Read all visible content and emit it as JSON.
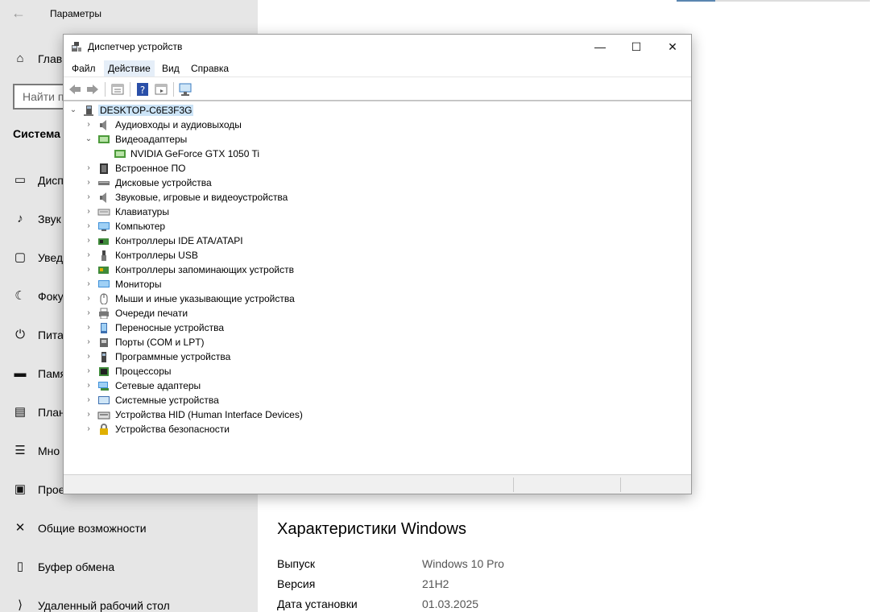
{
  "settings": {
    "title": "Параметры",
    "search_placeholder": "Найти пар",
    "section": "Система",
    "nav": [
      {
        "label": "Глав",
        "icon": "home-icon"
      },
      {
        "label": "Дисп",
        "icon": "display-icon"
      },
      {
        "label": "Звук",
        "icon": "sound-icon"
      },
      {
        "label": "Увед",
        "icon": "notifications-icon"
      },
      {
        "label": "Фоку",
        "icon": "focus-icon"
      },
      {
        "label": "Пита",
        "icon": "power-icon"
      },
      {
        "label": "Памя",
        "icon": "storage-icon"
      },
      {
        "label": "План",
        "icon": "tablet-icon"
      },
      {
        "label": "Мно",
        "icon": "multitasking-icon"
      },
      {
        "label": "Прое",
        "icon": "projecting-icon"
      },
      {
        "label": "Общие возможности",
        "icon": "shared-icon"
      },
      {
        "label": "Буфер обмена",
        "icon": "clipboard-icon"
      },
      {
        "label": "Удаленный рабочий стол",
        "icon": "remote-desktop-icon"
      }
    ],
    "spec_heading": "Характеристики Windows",
    "specs": [
      {
        "key": "Выпуск",
        "value": "Windows 10 Pro"
      },
      {
        "key": "Версия",
        "value": "21H2"
      },
      {
        "key": "Дата установки",
        "value": "01.03.2025"
      }
    ]
  },
  "device_manager": {
    "title": "Диспетчер устройств",
    "window_buttons": {
      "minimize": "—",
      "maximize": "☐",
      "close": "✕"
    },
    "menu": [
      "Файл",
      "Действие",
      "Вид",
      "Справка"
    ],
    "active_menu": "Действие",
    "root": "DESKTOP-C6E3F3G",
    "items": [
      {
        "label": "Аудиовходы и аудиовыходы",
        "icon": "audio-io-icon",
        "expanded": false
      },
      {
        "label": "Видеоадаптеры",
        "icon": "display-adapter-icon",
        "expanded": true,
        "children": [
          "NVIDIA GeForce GTX 1050 Ti"
        ]
      },
      {
        "label": "Встроенное ПО",
        "icon": "firmware-icon",
        "expanded": false
      },
      {
        "label": "Дисковые устройства",
        "icon": "disk-drive-icon",
        "expanded": false
      },
      {
        "label": "Звуковые, игровые и видеоустройства",
        "icon": "sound-device-icon",
        "expanded": false
      },
      {
        "label": "Клавиатуры",
        "icon": "keyboard-icon",
        "expanded": false
      },
      {
        "label": "Компьютер",
        "icon": "computer-icon",
        "expanded": false
      },
      {
        "label": "Контроллеры IDE ATA/ATAPI",
        "icon": "ide-controller-icon",
        "expanded": false
      },
      {
        "label": "Контроллеры USB",
        "icon": "usb-icon",
        "expanded": false
      },
      {
        "label": "Контроллеры запоминающих устройств",
        "icon": "storage-controller-icon",
        "expanded": false
      },
      {
        "label": "Мониторы",
        "icon": "monitor-icon",
        "expanded": false
      },
      {
        "label": "Мыши и иные указывающие устройства",
        "icon": "mouse-icon",
        "expanded": false
      },
      {
        "label": "Очереди печати",
        "icon": "printer-icon",
        "expanded": false
      },
      {
        "label": "Переносные устройства",
        "icon": "portable-device-icon",
        "expanded": false
      },
      {
        "label": "Порты (COM и LPT)",
        "icon": "port-icon",
        "expanded": false
      },
      {
        "label": "Программные устройства",
        "icon": "software-device-icon",
        "expanded": false
      },
      {
        "label": "Процессоры",
        "icon": "processor-icon",
        "expanded": false
      },
      {
        "label": "Сетевые адаптеры",
        "icon": "network-adapter-icon",
        "expanded": false
      },
      {
        "label": "Системные устройства",
        "icon": "system-device-icon",
        "expanded": false
      },
      {
        "label": "Устройства HID (Human Interface Devices)",
        "icon": "hid-icon",
        "expanded": false
      },
      {
        "label": "Устройства безопасности",
        "icon": "security-device-icon",
        "expanded": false
      }
    ]
  }
}
